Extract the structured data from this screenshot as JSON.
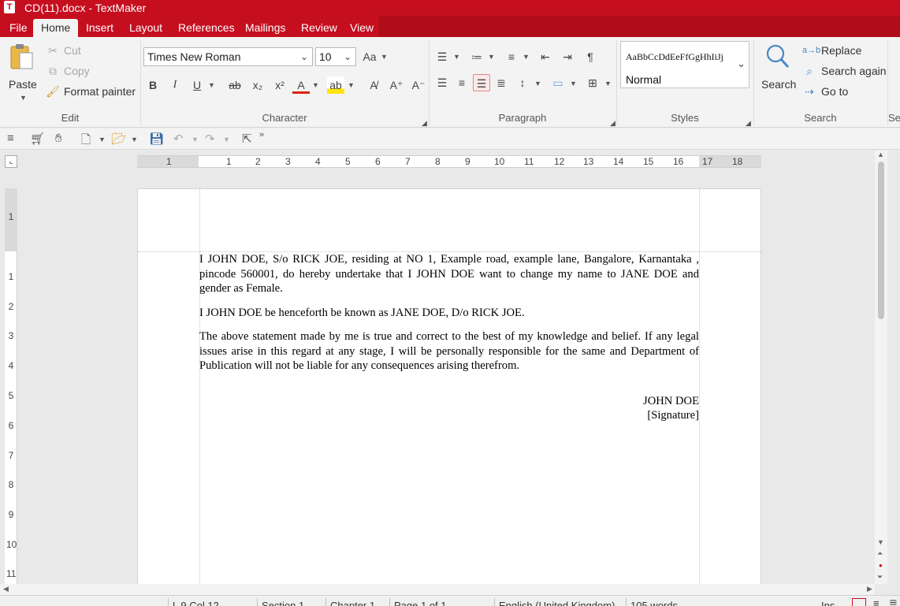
{
  "titlebar": {
    "title": "CD(11).docx - TextMaker"
  },
  "menu": {
    "file": "File",
    "home": "Home",
    "insert": "Insert",
    "layout": "Layout",
    "references": "References",
    "mailings": "Mailings",
    "review": "Review",
    "view": "View"
  },
  "ribbon": {
    "edit": {
      "paste": "Paste",
      "cut": "Cut",
      "copy": "Copy",
      "format_painter": "Format painter",
      "label": "Edit"
    },
    "character": {
      "font": "Times New Roman",
      "size": "10",
      "label": "Character",
      "bold": "B",
      "italic": "I",
      "underline": "U"
    },
    "paragraph": {
      "label": "Paragraph"
    },
    "styles": {
      "preview": "AaBbCcDdEeFfGgHhIiJj",
      "current": "Normal",
      "label": "Styles"
    },
    "search": {
      "search": "Search",
      "replace": "Replace",
      "search_again": "Search again",
      "goto": "Go to",
      "label": "Search",
      "next_group": "Se"
    }
  },
  "ruler": {
    "ticks": [
      "1",
      "1",
      "2",
      "3",
      "4",
      "5",
      "6",
      "7",
      "8",
      "9",
      "10",
      "11",
      "12",
      "13",
      "14",
      "15",
      "16",
      "17",
      "18"
    ]
  },
  "vruler": {
    "ticks": [
      "1",
      "1",
      "2",
      "3",
      "4",
      "5",
      "6",
      "7",
      "8",
      "9",
      "10",
      "11"
    ]
  },
  "document": {
    "p1": "I JOHN DOE, S/o RICK JOE, residing at NO 1, Example road, example lane, Bangalore, Karnantaka , pincode 560001, do hereby undertake that I JOHN DOE want to change my name to JANE DOE and gender as Female.",
    "p2": "I JOHN DOE be henceforth be known as JANE DOE, D/o RICK JOE.",
    "p3": "The above statement made by me is true and correct to the best of my knowledge and belief. If any legal issues arise in this regard at any stage, I will be personally responsible for the same and Department of Publication will not be liable for any consequences arising therefrom.",
    "sig_name": "JOHN DOE",
    "sig_label": "[Signature]"
  },
  "status": {
    "pos": "L 9 Col 12",
    "section": "Section 1",
    "chapter": "Chapter 1",
    "page": "Page 1 of 1",
    "language": "English (United Kingdom)",
    "words": "105 words",
    "mode": "Ins"
  },
  "colors": {
    "accent": "#c50f1f",
    "ribbon_bg": "#f3f3f3"
  }
}
